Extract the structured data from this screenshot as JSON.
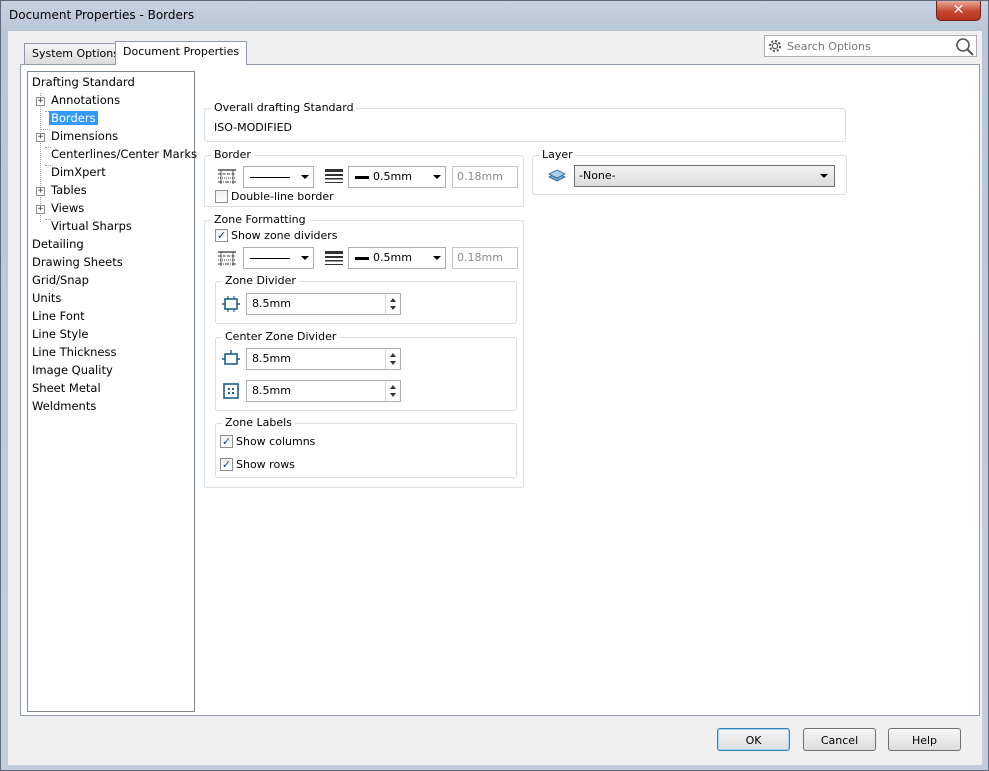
{
  "window": {
    "title": "Document Properties - Borders",
    "close_glyph": "✕"
  },
  "tabs": [
    {
      "label": "System Options",
      "active": false
    },
    {
      "label": "Document Properties",
      "active": true
    }
  ],
  "search": {
    "placeholder": "Search Options",
    "icon": "magnifier-icon",
    "settings_icon": "gear-icon"
  },
  "tree": {
    "items": [
      {
        "label": "Drafting Standard",
        "selected": false
      },
      {
        "label": "Annotations",
        "selected": false,
        "expander": "+"
      },
      {
        "label": "Borders",
        "selected": true
      },
      {
        "label": "Dimensions",
        "selected": false,
        "expander": "+"
      },
      {
        "label": "Centerlines/Center Marks",
        "selected": false
      },
      {
        "label": "DimXpert",
        "selected": false
      },
      {
        "label": "Tables",
        "selected": false,
        "expander": "+"
      },
      {
        "label": "Views",
        "selected": false,
        "expander": "+"
      },
      {
        "label": "Virtual Sharps",
        "selected": false
      },
      {
        "label": "Detailing",
        "selected": false
      },
      {
        "label": "Drawing Sheets",
        "selected": false
      },
      {
        "label": "Grid/Snap",
        "selected": false
      },
      {
        "label": "Units",
        "selected": false
      },
      {
        "label": "Line Font",
        "selected": false
      },
      {
        "label": "Line Style",
        "selected": false
      },
      {
        "label": "Line Thickness",
        "selected": false
      },
      {
        "label": "Image Quality",
        "selected": false
      },
      {
        "label": "Sheet Metal",
        "selected": false
      },
      {
        "label": "Weldments",
        "selected": false
      }
    ]
  },
  "overall": {
    "title": "Overall drafting Standard",
    "value": "ISO-MODIFIED"
  },
  "border": {
    "title": "Border",
    "line_thickness": "0.5mm",
    "custom_thickness": "0.18mm",
    "double_line": {
      "label": "Double-line border",
      "checked": false
    }
  },
  "layer": {
    "title": "Layer",
    "value": "-None-"
  },
  "zone": {
    "title": "Zone Formatting",
    "show_dividers": {
      "label": "Show zone dividers",
      "checked": true
    },
    "line_thickness": "0.5mm",
    "custom_thickness": "0.18mm",
    "divider": {
      "title": "Zone Divider",
      "value": "8.5mm"
    },
    "center_divider": {
      "title": "Center Zone Divider",
      "value1": "8.5mm",
      "value2": "8.5mm"
    },
    "labels": {
      "title": "Zone Labels",
      "show_columns": {
        "label": "Show columns",
        "checked": true
      },
      "show_rows": {
        "label": "Show rows",
        "checked": true
      }
    }
  },
  "buttons": {
    "ok": "OK",
    "cancel": "Cancel",
    "help": "Help"
  },
  "check_glyph": "✓",
  "colors": {
    "selection": "#3399ff",
    "title_close": "#c6462f"
  }
}
